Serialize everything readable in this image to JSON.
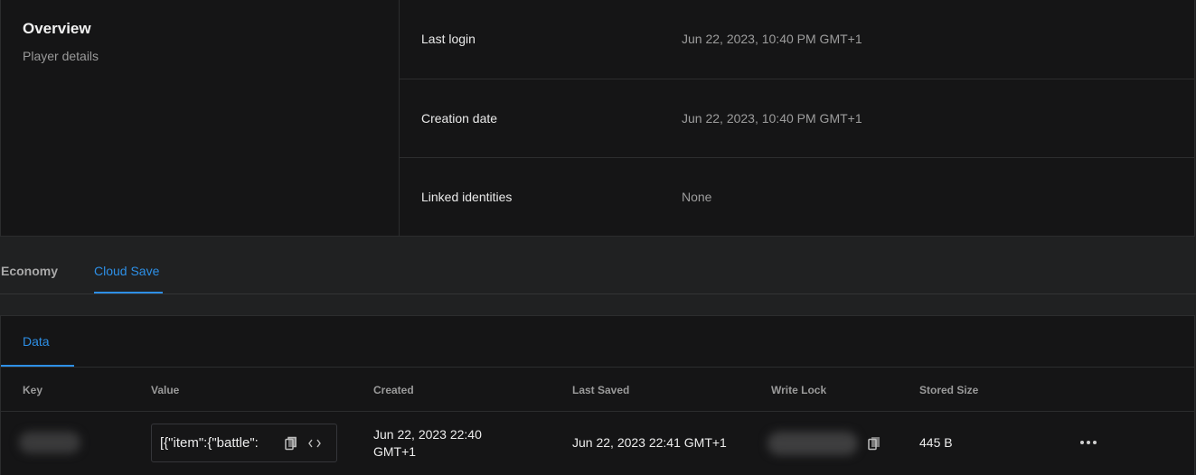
{
  "overview": {
    "title": "Overview",
    "subtitle": "Player details",
    "rows": [
      {
        "label": "Last login",
        "value": "Jun 22, 2023, 10:40 PM GMT+1"
      },
      {
        "label": "Creation date",
        "value": "Jun 22, 2023, 10:40 PM GMT+1"
      },
      {
        "label": "Linked identities",
        "value": "None"
      }
    ]
  },
  "tabs": [
    {
      "label": "Economy",
      "active": false
    },
    {
      "label": "Cloud Save",
      "active": true
    }
  ],
  "panel": {
    "subtab": "Data",
    "columns": [
      "Key",
      "Value",
      "Created",
      "Last Saved",
      "Write Lock",
      "Stored Size"
    ],
    "rows": [
      {
        "value": "[{\"item\":{\"battle\":",
        "created_line1": "Jun 22, 2023 22:40",
        "created_line2": "GMT+1",
        "last_saved": "Jun 22, 2023 22:41 GMT+1",
        "stored_size": "445 B"
      }
    ]
  },
  "icons": {
    "copy": "copy-icon",
    "code": "code-icon",
    "more": "more-horizontal-icon"
  },
  "colors": {
    "accent": "#2d8fe6",
    "background": "#202122",
    "card": "#151516"
  }
}
